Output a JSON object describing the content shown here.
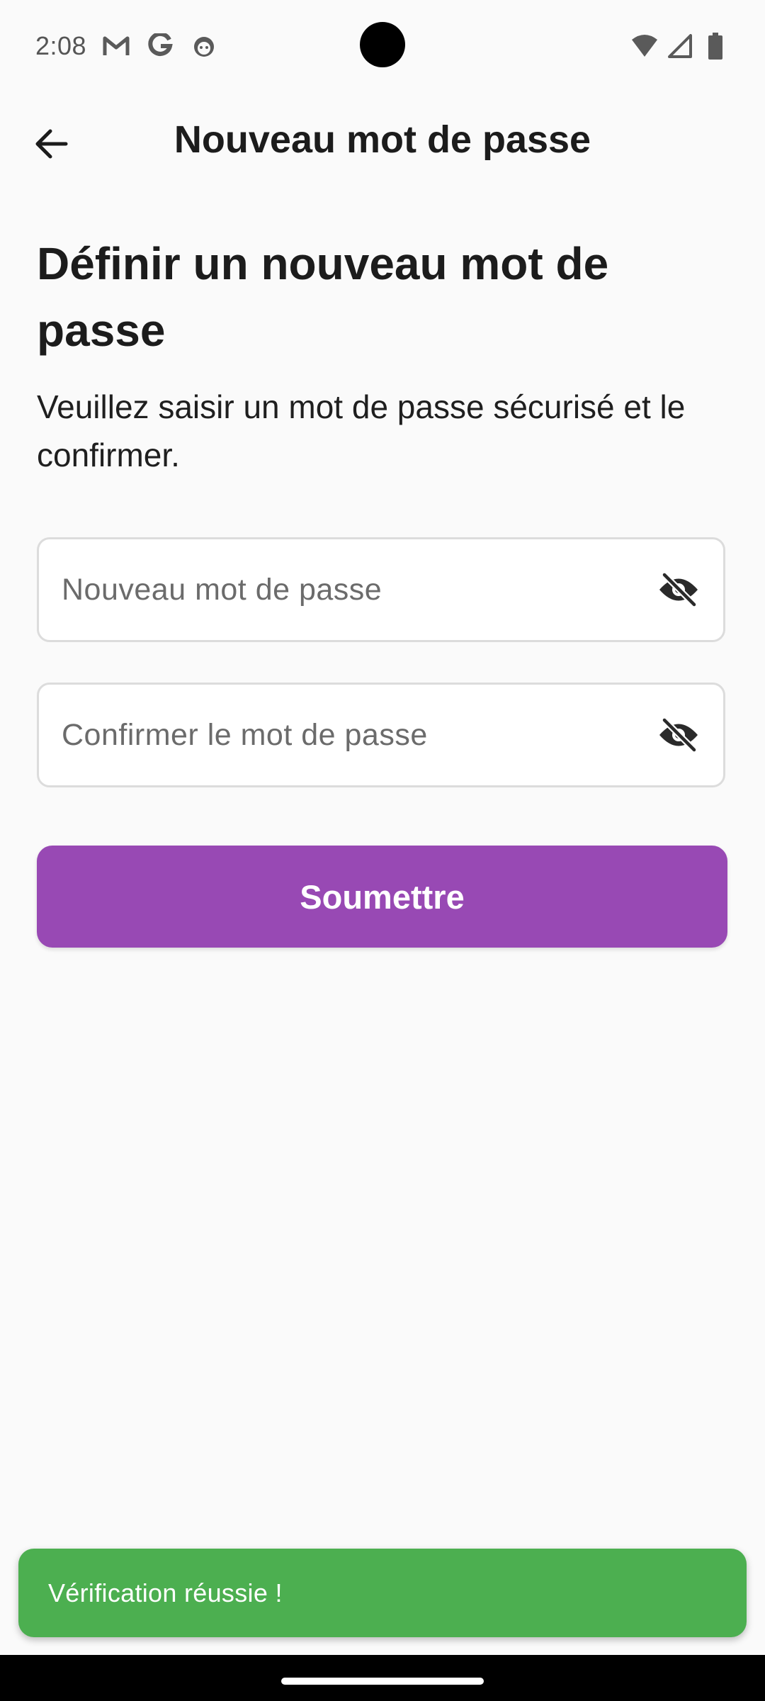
{
  "status_bar": {
    "time": "2:08",
    "icons_left": [
      "gmail-icon",
      "google-icon",
      "android-face-icon"
    ],
    "icons_right": [
      "wifi-icon",
      "signal-icon",
      "battery-icon"
    ]
  },
  "app_bar": {
    "back_icon": "arrow-left-icon",
    "title": "Nouveau mot de passe"
  },
  "content": {
    "heading": "Définir un nouveau mot de passe",
    "description": "Veuillez saisir un mot de passe sécurisé et le confirmer."
  },
  "form": {
    "new_password": {
      "placeholder": "Nouveau mot de passe",
      "value": "",
      "toggle_icon": "eye-off-icon"
    },
    "confirm_password": {
      "placeholder": "Confirmer le mot de passe",
      "value": "",
      "toggle_icon": "eye-off-icon"
    },
    "submit_label": "Soumettre"
  },
  "snackbar": {
    "message": "Vérification réussie !"
  },
  "colors": {
    "primary": "#9849b4",
    "success": "#4caf50",
    "background": "#fafafa"
  }
}
